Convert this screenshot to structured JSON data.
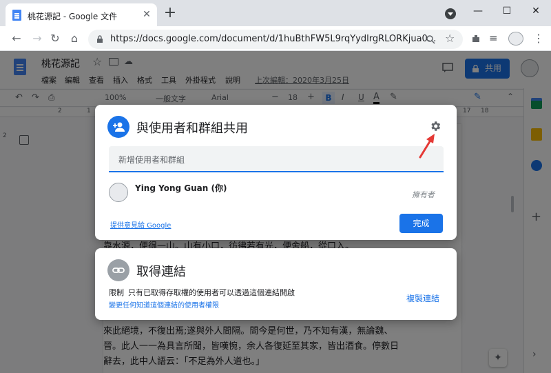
{
  "browser": {
    "tab_title": "桃花源記 - Google 文件",
    "tab_close": "✕",
    "new_tab": "+",
    "url": "https://docs.google.com/document/d/1huBthFW5L9rqYydlrgRLORKjua0...",
    "window": {
      "minimize": "—",
      "maximize": "☐",
      "close": "✕"
    }
  },
  "docs": {
    "title": "桃花源記",
    "menu": [
      "檔案",
      "編輯",
      "查看",
      "插入",
      "格式",
      "工具",
      "外掛程式",
      "說明"
    ],
    "last_edit": "上次編輯：2020年3月25日",
    "share_label": "共用",
    "toolbar": {
      "zoom": "100%",
      "style": "一般文字",
      "font": "Arial",
      "font_size": "18",
      "bold": "B",
      "italic": "I",
      "underline": "U",
      "text_color": "A"
    },
    "ruler_left": "2",
    "ruler_right_a": "17",
    "ruler_right_b": "18",
    "ruler_margin": "1",
    "vertical_ruler": "2",
    "body_lines": [
      "靠水源，便得一山。山有小口，彷彿若有光，便舍船，從口入。",
      "來此絕境，不復出焉;遂與外人間隔。問今是何世，乃不知有漢，無論魏、",
      "晉。此人一一為具言所聞，皆嘆惋，余人各復延至其家，皆出酒食。停數日",
      "辭去，此中人語云：「不足為外人道也。」"
    ]
  },
  "share_dialog": {
    "title": "與使用者和群組共用",
    "input_placeholder": "新增使用者和群組",
    "user": {
      "name": "Ying Yong Guan (你)",
      "role": "擁有者"
    },
    "feedback_link": "提供意見給 Google",
    "done_label": "完成"
  },
  "link_dialog": {
    "title": "取得連結",
    "restricted_label": "限制",
    "description": "只有已取得存取權的使用者可以透過這個連結開啟",
    "change_link": "變更任何知道這個連結的使用者權限",
    "copy_link": "複製連結"
  },
  "colors": {
    "accent": "#1a73e8",
    "annotation_arrow": "#e53935",
    "docs_blue": "#4285f4"
  },
  "icons": [
    "docs-icon",
    "star-icon",
    "folder-move-icon",
    "cloud-icon",
    "comment-icon",
    "lock-icon",
    "gear-icon",
    "add-person-icon",
    "link-icon",
    "avatar-icon"
  ]
}
